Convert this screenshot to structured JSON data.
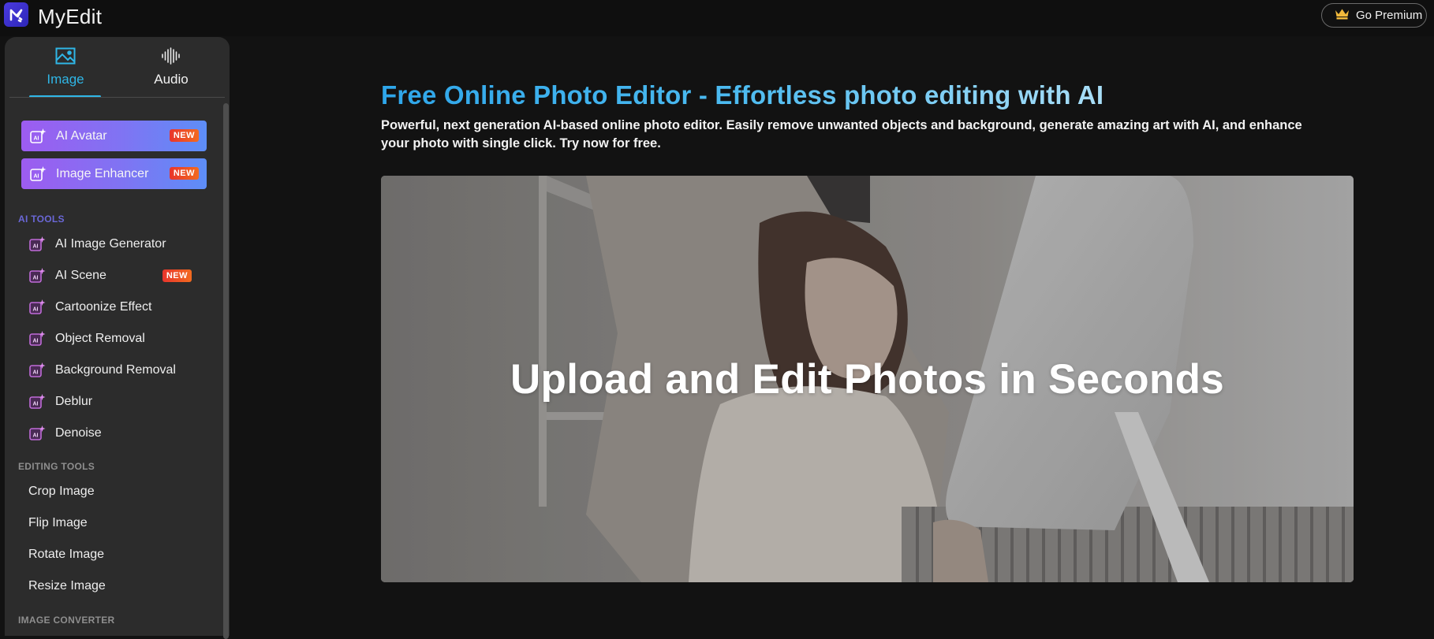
{
  "app": {
    "name": "MyEdit",
    "logo_icon": "myedit-logo-icon"
  },
  "header": {
    "premium_label": "Go Premium",
    "premium_icon": "crown-icon"
  },
  "sidebar": {
    "tabs": [
      {
        "label": "Image",
        "icon": "image-icon",
        "active": true
      },
      {
        "label": "Audio",
        "icon": "audio-waveform-icon",
        "active": false
      }
    ],
    "featured": [
      {
        "label": "AI Avatar",
        "badge": "NEW",
        "icon": "ai-sparkle-icon"
      },
      {
        "label": "Image Enhancer",
        "badge": "NEW",
        "icon": "ai-sparkle-icon"
      }
    ],
    "sections": [
      {
        "title": "AI TOOLS",
        "items": [
          {
            "label": "AI Image Generator",
            "icon": "ai-sparkle-icon"
          },
          {
            "label": "AI Scene",
            "icon": "ai-sparkle-icon",
            "badge": "NEW"
          },
          {
            "label": "Cartoonize Effect",
            "icon": "ai-sparkle-icon"
          },
          {
            "label": "Object Removal",
            "icon": "ai-sparkle-icon"
          },
          {
            "label": "Background Removal",
            "icon": "ai-sparkle-icon"
          },
          {
            "label": "Deblur",
            "icon": "ai-sparkle-icon"
          },
          {
            "label": "Denoise",
            "icon": "ai-sparkle-icon"
          }
        ]
      },
      {
        "title": "EDITING TOOLS",
        "items": [
          {
            "label": "Crop Image"
          },
          {
            "label": "Flip Image"
          },
          {
            "label": "Rotate Image"
          },
          {
            "label": "Resize Image"
          }
        ]
      },
      {
        "title": "IMAGE CONVERTER",
        "items": []
      }
    ]
  },
  "main": {
    "title": "Free Online Photo Editor - Effortless photo editing with AI",
    "description": "Powerful, next generation AI-based online photo editor. Easily remove unwanted objects and background, generate amazing art with AI, and enhance your photo with single click. Try now for free.",
    "hero_text": "Upload and Edit Photos in Seconds"
  },
  "colors": {
    "accent": "#2fb6e6",
    "background": "#121212",
    "sidebar": "#2c2c2c",
    "featured_gradient_start": "#9d5cf0",
    "featured_gradient_end": "#5d8ef7",
    "badge": "#e8352c",
    "section_ai": "#6a67d6"
  }
}
